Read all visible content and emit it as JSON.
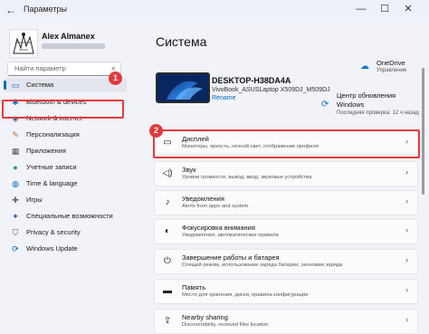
{
  "titlebar": {
    "back": "←",
    "title": "Параметры",
    "minimize": "—",
    "maximize": "☐",
    "close": "✕"
  },
  "user": {
    "name": "Alex Almanex"
  },
  "search": {
    "placeholder": "Найти параметр",
    "icon": "search-icon"
  },
  "sidebar": {
    "items": [
      {
        "label": "Система",
        "icon": "monitor-icon",
        "glyph": "▭",
        "color": "#0067c0",
        "active": true
      },
      {
        "label": "Bluetooth & devices",
        "icon": "bluetooth-icon",
        "glyph": "✱",
        "color": "#0067c0"
      },
      {
        "label": "Network & internet",
        "icon": "wifi-icon",
        "glyph": "◈",
        "color": "#2a5fa8"
      },
      {
        "label": "Персонализация",
        "icon": "brush-icon",
        "glyph": "✎",
        "color": "#c76b22"
      },
      {
        "label": "Приложения",
        "icon": "apps-icon",
        "glyph": "▦",
        "color": "#555"
      },
      {
        "label": "Учетные записи",
        "icon": "person-icon",
        "glyph": "●",
        "color": "#2ea044"
      },
      {
        "label": "Time & language",
        "icon": "globe-icon",
        "glyph": "◍",
        "color": "#0067c0"
      },
      {
        "label": "Игры",
        "icon": "gamepad-icon",
        "glyph": "✚",
        "color": "#666"
      },
      {
        "label": "Специальные возможности",
        "icon": "accessibility-icon",
        "glyph": "✦",
        "color": "#1a5fb4"
      },
      {
        "label": "Privacy & security",
        "icon": "shield-icon",
        "glyph": "⛉",
        "color": "#555"
      },
      {
        "label": "Windows Update",
        "icon": "update-icon",
        "glyph": "⟳",
        "color": "#0067c0"
      }
    ]
  },
  "main": {
    "title": "Система",
    "device": {
      "name": "DESKTOP-H38DA4A",
      "model": "VivoBook_ASUSLaptop X509DJ_M509DJ",
      "rename": "Rename"
    },
    "onedrive": {
      "title": "OneDrive",
      "subtitle": "Управление"
    },
    "windows_update": {
      "title": "Центр обновления Windows",
      "subtitle": "Последняя проверка: 12 ч назад"
    },
    "cards": [
      {
        "title": "Дисплей",
        "desc": "Мониторы, яркость, ночной свет, отображение профиля",
        "icon": "display-icon",
        "glyph": "▭"
      },
      {
        "title": "Звук",
        "desc": "Уровни громкости, вывод, ввод, звуковые устройства",
        "icon": "speaker-icon",
        "glyph": "◁)"
      },
      {
        "title": "Уведомления",
        "desc": "Alerts from apps and system",
        "icon": "bell-icon",
        "glyph": "♪"
      },
      {
        "title": "Фокусировка внимания",
        "desc": "Уведомления, автоматические правила",
        "icon": "focus-icon",
        "glyph": "◐"
      },
      {
        "title": "Завершение работы и батарея",
        "desc": "Спящий режим, использование заряда батареи, экономия заряда",
        "icon": "power-icon",
        "glyph": "⏻"
      },
      {
        "title": "Память",
        "desc": "Место для хранения, диски, правила конфигурации",
        "icon": "storage-icon",
        "glyph": "▬"
      },
      {
        "title": "Nearby sharing",
        "desc": "Discoverability, received files location",
        "icon": "share-icon",
        "glyph": "⇪"
      }
    ]
  },
  "annotations": {
    "badge1": "1",
    "badge2": "2"
  },
  "colors": {
    "accent": "#0067c0",
    "highlight": "#e8393d"
  }
}
